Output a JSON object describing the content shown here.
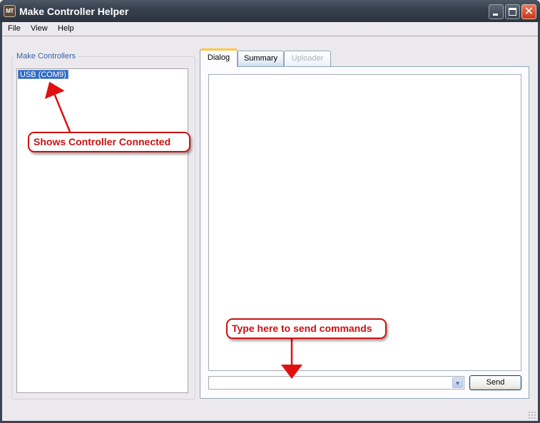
{
  "window": {
    "app_icon_text": "MT",
    "title": "Make Controller Helper",
    "controls": {
      "minimize": "minimize",
      "maximize": "maximize",
      "close": "✕"
    }
  },
  "menubar": {
    "items": [
      "File",
      "View",
      "Help"
    ]
  },
  "left_panel": {
    "group_label": "Make Controllers",
    "devices": [
      {
        "label": "USB (COM9)",
        "selected": true
      }
    ]
  },
  "tabs": [
    {
      "label": "Dialog",
      "state": "active"
    },
    {
      "label": "Summary",
      "state": "normal"
    },
    {
      "label": "Uploader",
      "state": "disabled"
    }
  ],
  "dialog": {
    "output_text": "",
    "command_input": {
      "value": "",
      "placeholder": ""
    },
    "combo_arrow_icon": "▾",
    "send_label": "Send"
  },
  "annotations": [
    {
      "text": "Shows Controller Connected",
      "color": "#cc1111"
    },
    {
      "text": "Type here to send commands",
      "color": "#cc1111"
    }
  ]
}
